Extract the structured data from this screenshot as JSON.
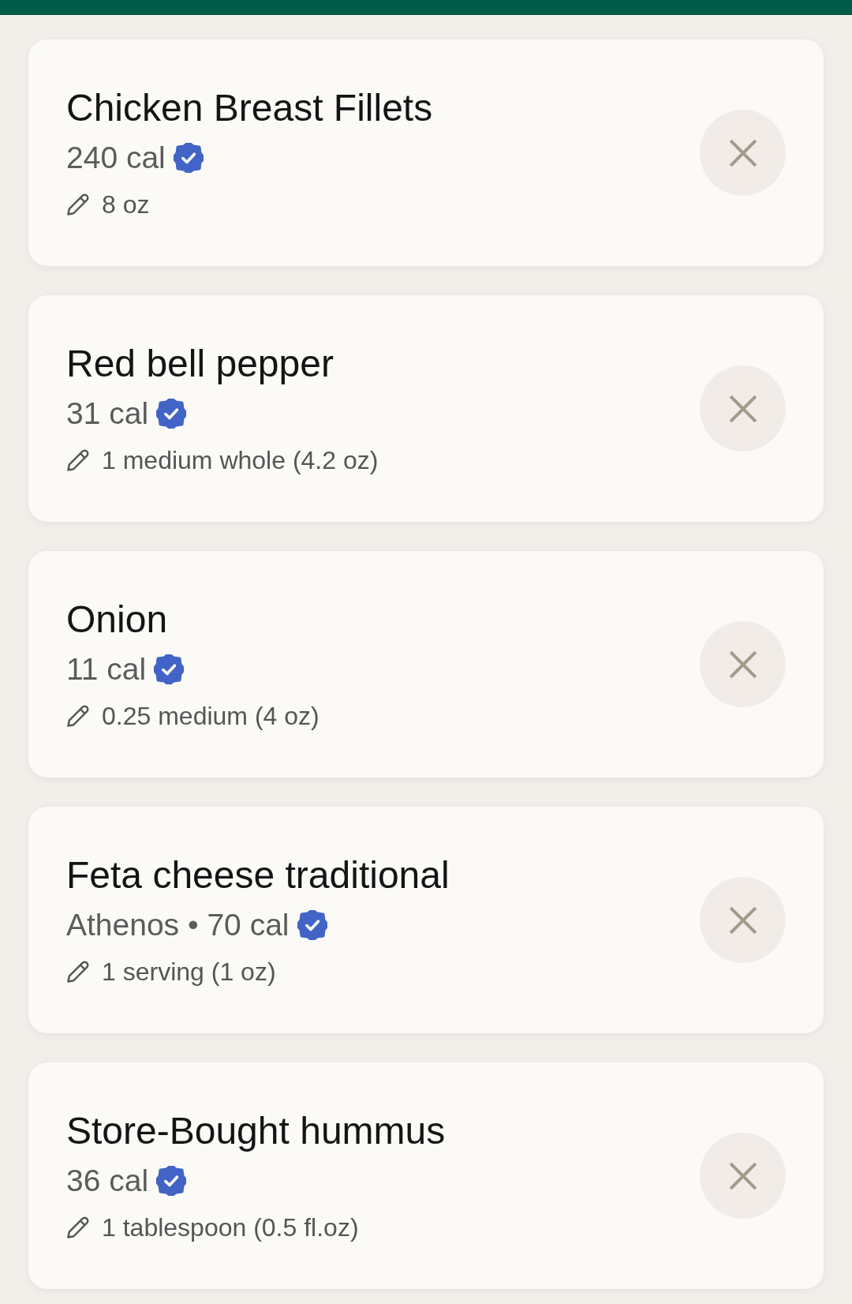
{
  "items": [
    {
      "name": "Chicken Breast Fillets",
      "calories_line": "240 cal",
      "verified": true,
      "serving": "8 oz"
    },
    {
      "name": "Red bell pepper",
      "calories_line": "31 cal",
      "verified": true,
      "serving": "1 medium whole (4.2 oz)"
    },
    {
      "name": "Onion",
      "calories_line": "11 cal",
      "verified": true,
      "serving": "0.25 medium (4 oz)"
    },
    {
      "name": "Feta cheese traditional",
      "calories_line": "Athenos • 70 cal",
      "verified": true,
      "serving": "1 serving (1 oz)"
    },
    {
      "name": "Store-Bought hummus",
      "calories_line": "36 cal",
      "verified": true,
      "serving": "1 tablespoon (0.5 fl.oz)"
    }
  ]
}
